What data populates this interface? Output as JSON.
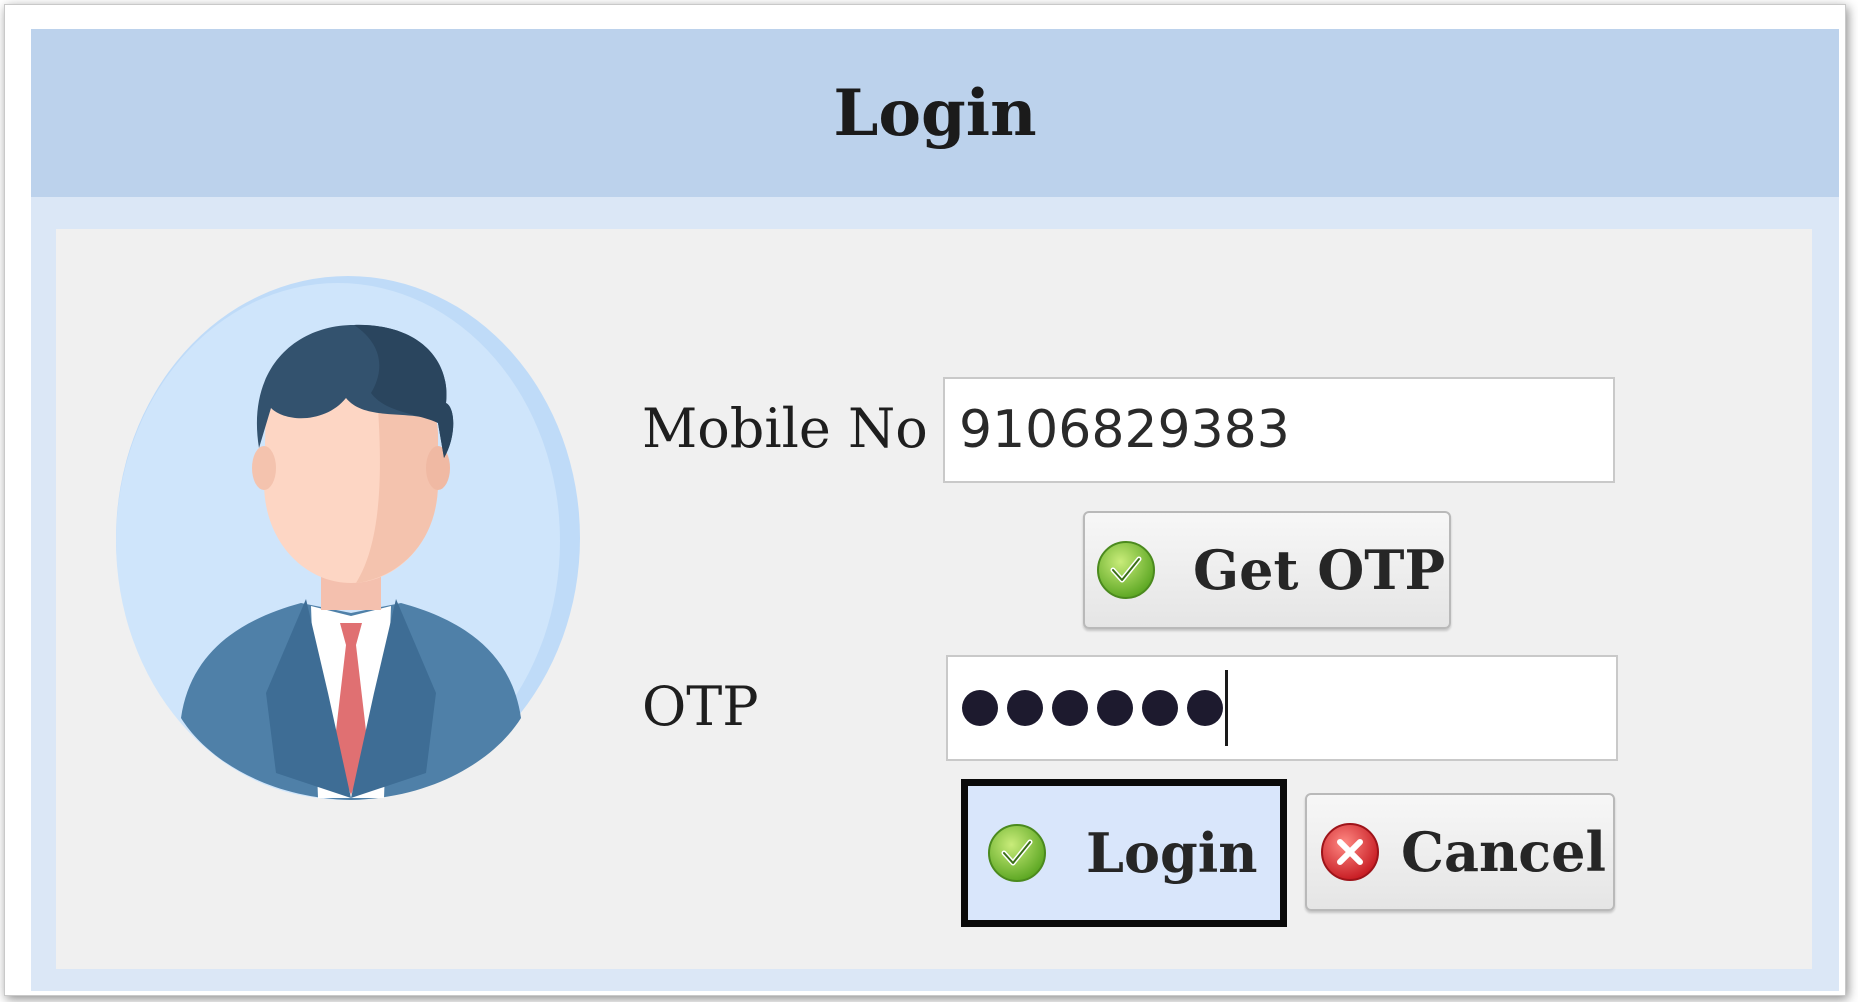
{
  "window": {
    "title": "Login"
  },
  "form": {
    "mobile_label": "Mobile No",
    "mobile_value": "9106829383",
    "otp_label": "OTP",
    "otp_masked_length": 6
  },
  "buttons": {
    "get_otp": "Get OTP",
    "login": "Login",
    "cancel": "Cancel"
  },
  "icons": {
    "avatar": "user-avatar-icon",
    "check": "green-check-icon",
    "cancel": "red-x-icon"
  },
  "colors": {
    "titlebar": "#bcd2ec",
    "panel": "#f0f0f0",
    "check_green": "#8cc63f",
    "cancel_red": "#e2363b",
    "focus_border": "#0a0a0a"
  }
}
